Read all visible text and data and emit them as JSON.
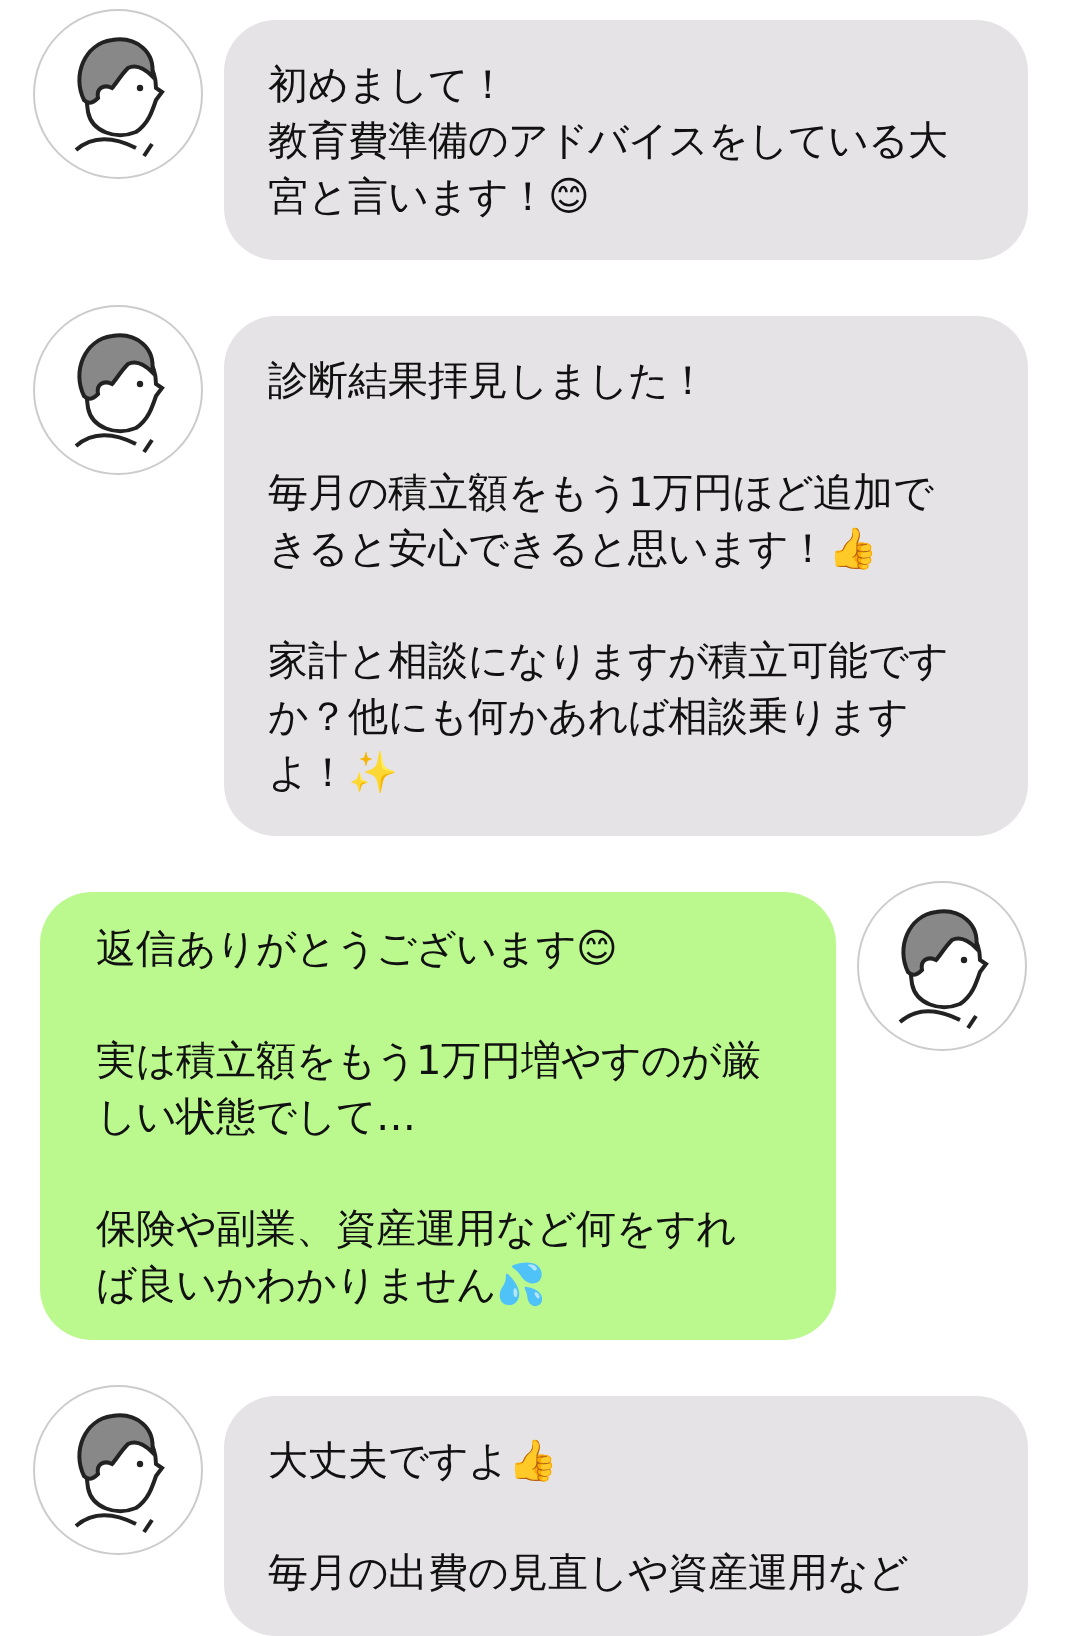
{
  "messages": [
    {
      "kind": "received",
      "paragraphs": [
        [
          "初めまして！",
          "教育費準備のアドバイスをしている大",
          "宮と言います！😊"
        ]
      ]
    },
    {
      "kind": "received",
      "paragraphs": [
        [
          "診断結果拝見しました！"
        ],
        [
          "毎月の積立額をもう1万円ほど追加で",
          "きると安心できると思います！👍"
        ],
        [
          "家計と相談になりますが積立可能です",
          "か？他にも何かあれば相談乗ります",
          "よ！✨"
        ]
      ]
    },
    {
      "kind": "sent",
      "paragraphs": [
        [
          "返信ありがとうございます😊"
        ],
        [
          "実は積立額をもう1万円増やすのが厳",
          "しい状態でして…"
        ],
        [
          "保険や副業、資産運用など何をすれ",
          "ば良いかわかりません💦"
        ]
      ]
    },
    {
      "kind": "received",
      "paragraphs": [
        [
          "大丈夫ですよ👍"
        ],
        [
          "毎月の出費の見直しや資産運用など"
        ]
      ]
    }
  ]
}
